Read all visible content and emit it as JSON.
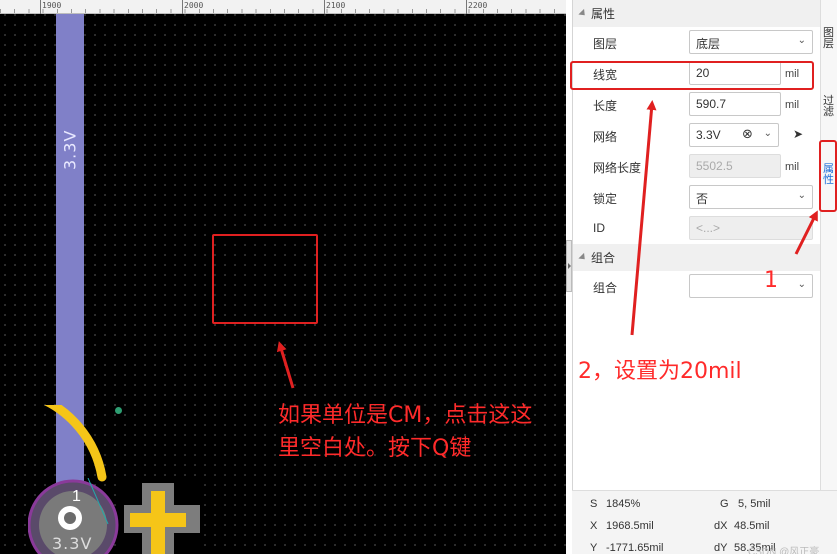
{
  "ruler": {
    "labels": [
      "1900",
      "2000",
      "2100",
      "2200"
    ]
  },
  "canvas": {
    "track_net_label": "3.3V",
    "pad_number": "1",
    "pad_net_label": "3.3V",
    "annotation_line1": "如果单位是CM，点击这这",
    "annotation_line2": "里空白处。按下Q键"
  },
  "panel": {
    "properties_section": "属性",
    "rows": {
      "layer": {
        "label": "图层",
        "value": "底层"
      },
      "width": {
        "label": "线宽",
        "value": "20",
        "unit": "mil"
      },
      "length": {
        "label": "长度",
        "value": "590.7",
        "unit": "mil"
      },
      "net": {
        "label": "网络",
        "value": "3.3V"
      },
      "net_length": {
        "label": "网络长度",
        "value": "5502.5",
        "unit": "mil"
      },
      "lock": {
        "label": "锁定",
        "value": "否"
      },
      "id": {
        "label": "ID",
        "value": "<...>"
      }
    },
    "group_section": "组合",
    "group": {
      "label": "组合",
      "value": ""
    }
  },
  "right_tabs": {
    "layers": "图层",
    "filter": "过滤",
    "properties": "属性"
  },
  "status": {
    "s_label": "S",
    "s_value": "1845%",
    "g_label": "G",
    "g_value": "5, 5mil",
    "x_label": "X",
    "x_value": "1968.5mil",
    "dx_label": "dX",
    "dx_value": "48.5mil",
    "y_label": "Y",
    "y_value": "-1771.65mil",
    "dy_label": "dY",
    "dy_value": "58.35mil"
  },
  "watermark": "CSDN @风正豪",
  "annotations": {
    "step1": "1",
    "step2": "2，设置为20mil"
  },
  "colors": {
    "annotation_red": "#e02020",
    "track": "#8080c8",
    "active_tab": "#1e6fd9"
  }
}
